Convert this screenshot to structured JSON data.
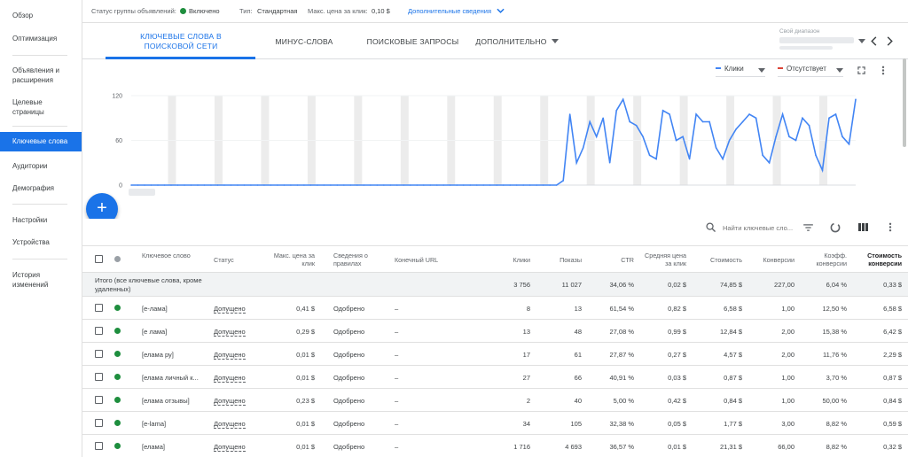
{
  "sidebar": {
    "items": [
      {
        "label": "Обзор"
      },
      {
        "label": "Оптимизация"
      },
      {
        "label": "Объявления и расширения"
      },
      {
        "label": "Целевые страницы"
      },
      {
        "label": "Ключевые слова"
      },
      {
        "label": "Аудитории"
      },
      {
        "label": "Демография"
      },
      {
        "label": "Настройки"
      },
      {
        "label": "Устройства"
      },
      {
        "label": "История изменений"
      }
    ]
  },
  "status_bar": {
    "group_status_label": "Статус группы объявлений:",
    "group_status_value": "Включено",
    "type_label": "Тип:",
    "type_value": "Стандартная",
    "max_cpc_label": "Макс. цена за клик:",
    "max_cpc_value": "0,10 $",
    "more_link": "Дополнительные сведения"
  },
  "tabs": [
    {
      "label": "КЛЮЧЕВЫЕ СЛОВА В ПОИСКОВОЙ СЕТИ",
      "active": true
    },
    {
      "label": "МИНУС-СЛОВА"
    },
    {
      "label": "ПОИСКОВЫЕ ЗАПРОСЫ"
    },
    {
      "label": "ДОПОЛНИТЕЛЬНО"
    }
  ],
  "date_range": {
    "label": "Свой диапазон"
  },
  "chart_controls": {
    "metric1": "Клики",
    "metric2": "Отсутствует",
    "metric1_color": "#4285f4",
    "metric2_color": "#db4437"
  },
  "chart_data": {
    "type": "line",
    "series": [
      {
        "name": "Клики",
        "color": "#4285f4",
        "values": [
          0,
          0,
          0,
          0,
          0,
          0,
          0,
          0,
          0,
          0,
          0,
          0,
          0,
          0,
          0,
          0,
          0,
          0,
          0,
          0,
          0,
          0,
          0,
          0,
          0,
          0,
          0,
          0,
          0,
          0,
          0,
          0,
          0,
          0,
          0,
          0,
          0,
          0,
          0,
          0,
          0,
          0,
          0,
          0,
          0,
          0,
          0,
          0,
          0,
          0,
          0,
          0,
          0,
          0,
          0,
          0,
          0,
          0,
          0,
          0,
          0,
          0,
          0,
          0,
          0,
          6,
          95,
          30,
          50,
          85,
          65,
          90,
          30,
          100,
          115,
          85,
          80,
          65,
          40,
          35,
          100,
          95,
          60,
          65,
          35,
          95,
          85,
          85,
          50,
          35,
          60,
          75,
          85,
          95,
          90,
          40,
          30,
          65,
          95,
          65,
          60,
          90,
          80,
          40,
          20,
          90,
          95,
          65,
          55,
          115
        ],
        "note_ignore": ""
      }
    ],
    "yticks": [
      "120",
      "60",
      "0"
    ],
    "ylim": [
      0,
      120
    ]
  },
  "search": {
    "placeholder": "Найти ключевые сло..."
  },
  "table": {
    "headers": {
      "keyword": "Ключевое слово",
      "status": "Статус",
      "max_cpc": "Макс. цена за клик",
      "rules": "Сведения о правилах",
      "final_url": "Конечный URL",
      "clicks": "Клики",
      "impr": "Показы",
      "ctr": "CTR",
      "avg_cpc": "Средняя цена за клик",
      "cost": "Стоимость",
      "conv": "Конверсии",
      "conv_rate": "Коэфф. конверсии",
      "cost_conv": "Стоимость конверсии"
    },
    "total": {
      "label": "Итого (все ключевые слова, кроме удаленных)",
      "clicks": "3 756",
      "impr": "11 027",
      "ctr": "34,06 %",
      "avg_cpc": "0,02 $",
      "cost": "74,85 $",
      "conv": "227,00",
      "conv_rate": "6,04 %",
      "cost_conv": "0,33 $"
    },
    "rows": [
      {
        "keyword": "[е-лама]",
        "status": "Допущено",
        "max_cpc": "0,41 $",
        "rules": "Одобрено",
        "final_url": "–",
        "clicks": "8",
        "impr": "13",
        "ctr": "61,54 %",
        "avg_cpc": "0,82 $",
        "cost": "6,58 $",
        "conv": "1,00",
        "conv_rate": "12,50 %",
        "cost_conv": "6,58 $"
      },
      {
        "keyword": "[е лама]",
        "status": "Допущено",
        "max_cpc": "0,29 $",
        "rules": "Одобрено",
        "final_url": "–",
        "clicks": "13",
        "impr": "48",
        "ctr": "27,08 %",
        "avg_cpc": "0,99 $",
        "cost": "12,84 $",
        "conv": "2,00",
        "conv_rate": "15,38 %",
        "cost_conv": "6,42 $"
      },
      {
        "keyword": "[елама ру]",
        "status": "Допущено",
        "max_cpc": "0,01 $",
        "rules": "Одобрено",
        "final_url": "–",
        "clicks": "17",
        "impr": "61",
        "ctr": "27,87 %",
        "avg_cpc": "0,27 $",
        "cost": "4,57 $",
        "conv": "2,00",
        "conv_rate": "11,76 %",
        "cost_conv": "2,29 $"
      },
      {
        "keyword": "[елама личный к...",
        "status": "Допущено",
        "max_cpc": "0,01 $",
        "rules": "Одобрено",
        "final_url": "–",
        "clicks": "27",
        "impr": "66",
        "ctr": "40,91 %",
        "avg_cpc": "0,03 $",
        "cost": "0,87 $",
        "conv": "1,00",
        "conv_rate": "3,70 %",
        "cost_conv": "0,87 $"
      },
      {
        "keyword": "[елама отзывы]",
        "status": "Допущено",
        "max_cpc": "0,23 $",
        "rules": "Одобрено",
        "final_url": "–",
        "clicks": "2",
        "impr": "40",
        "ctr": "5,00 %",
        "avg_cpc": "0,42 $",
        "cost": "0,84 $",
        "conv": "1,00",
        "conv_rate": "50,00 %",
        "cost_conv": "0,84 $"
      },
      {
        "keyword": "[e-lama]",
        "status": "Допущено",
        "max_cpc": "0,01 $",
        "rules": "Одобрено",
        "final_url": "–",
        "clicks": "34",
        "impr": "105",
        "ctr": "32,38 %",
        "avg_cpc": "0,05 $",
        "cost": "1,77 $",
        "conv": "3,00",
        "conv_rate": "8,82 %",
        "cost_conv": "0,59 $"
      },
      {
        "keyword": "[елама]",
        "status": "Допущено",
        "max_cpc": "0,01 $",
        "rules": "Одобрено",
        "final_url": "–",
        "clicks": "1 716",
        "impr": "4 693",
        "ctr": "36,57 %",
        "avg_cpc": "0,01 $",
        "cost": "21,31 $",
        "conv": "66,00",
        "conv_rate": "8,82 %",
        "cost_conv": "0,32 $"
      }
    ]
  }
}
